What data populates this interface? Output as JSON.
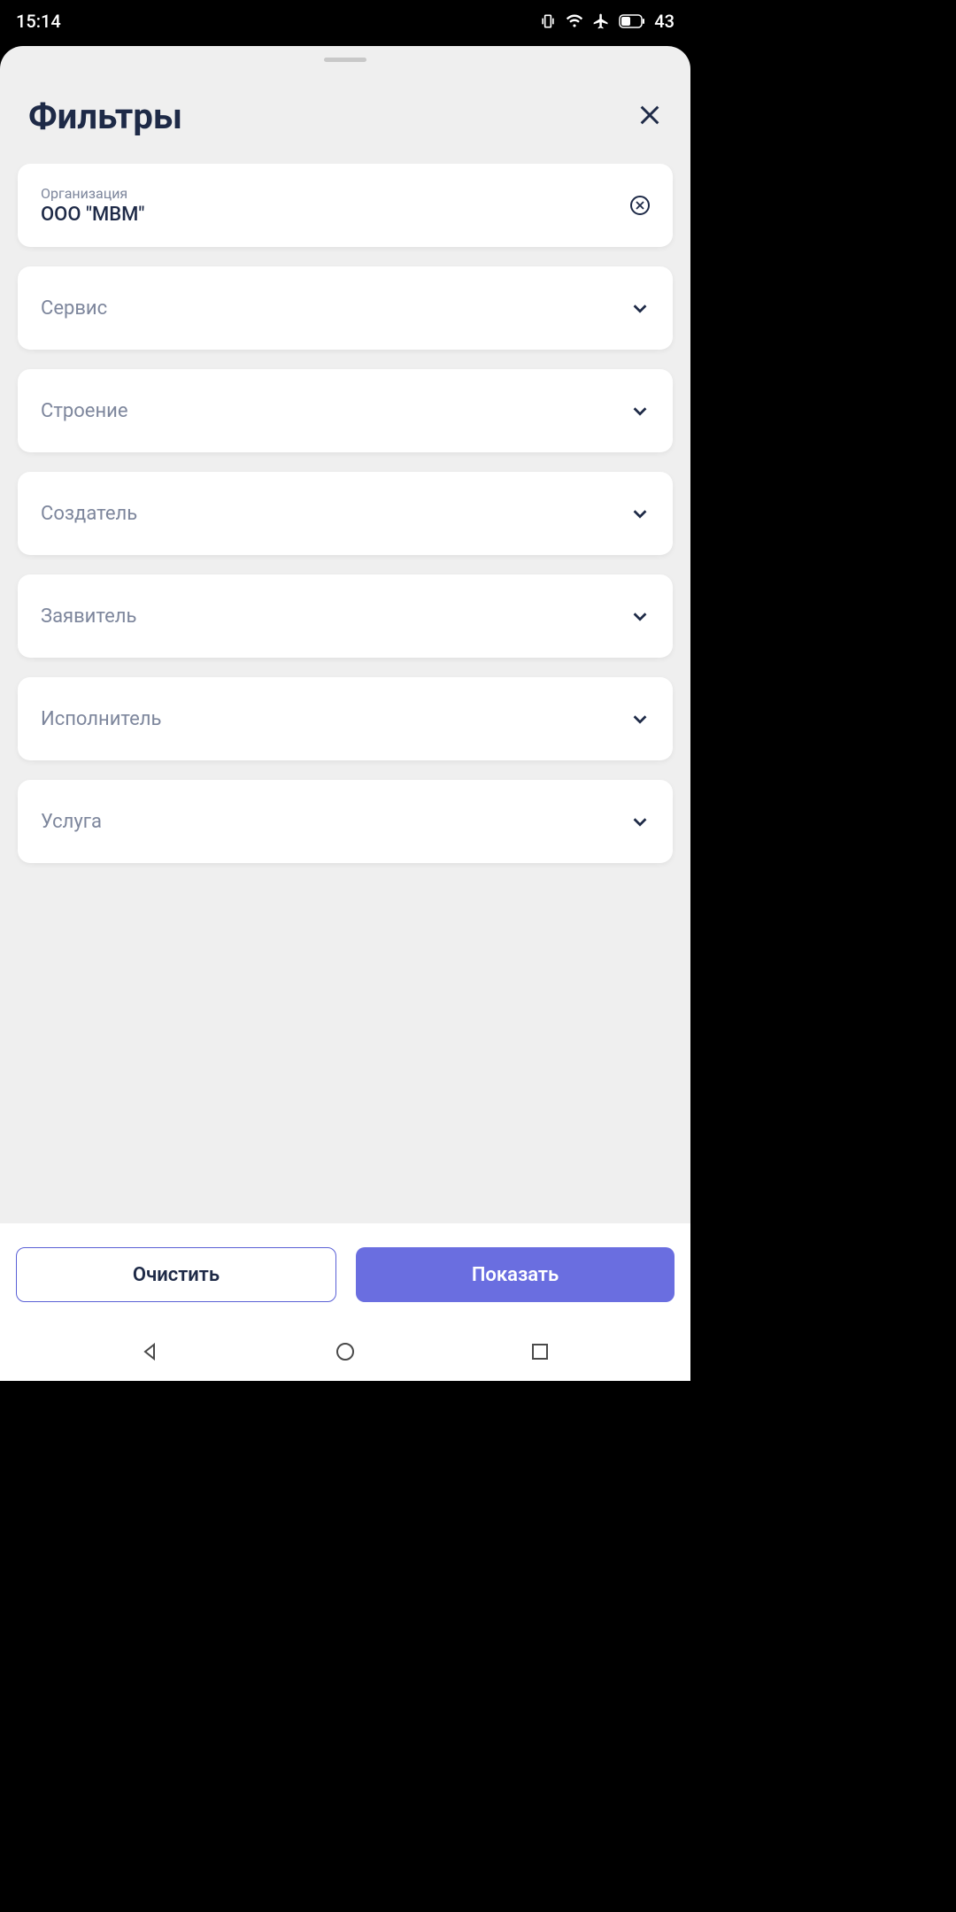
{
  "status": {
    "time": "15:14",
    "battery": "43"
  },
  "sheet": {
    "title": "Фильтры"
  },
  "filters": {
    "organization": {
      "label": "Организация",
      "value": "ООО \"МВМ\""
    },
    "service": {
      "label": "Сервис"
    },
    "building": {
      "label": "Строение"
    },
    "creator": {
      "label": "Создатель"
    },
    "applicant": {
      "label": "Заявитель"
    },
    "executor": {
      "label": "Исполнитель"
    },
    "service_type": {
      "label": "Услуга"
    }
  },
  "buttons": {
    "clear": "Очистить",
    "show": "Показать"
  },
  "colors": {
    "primary": "#6a6ee0",
    "text_dark": "#1e2a47",
    "text_muted": "#7d869c",
    "sheet_bg": "#efefef"
  }
}
